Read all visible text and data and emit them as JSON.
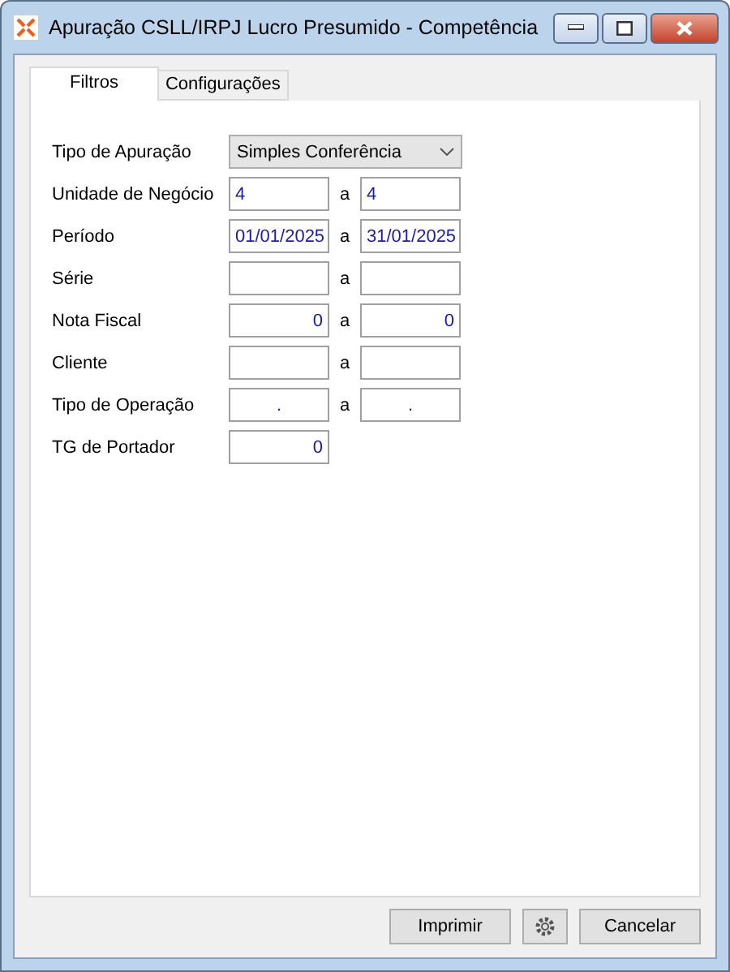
{
  "window": {
    "title": "Apuração CSLL/IRPJ Lucro Presumido - Competência"
  },
  "tabs": [
    {
      "label": "Filtros",
      "selected": true
    },
    {
      "label": "Configurações",
      "selected": false
    }
  ],
  "rows": [
    {
      "kind": "combo",
      "label": "Tipo de Apuração",
      "value": "Simples Conferência"
    },
    {
      "kind": "text-range",
      "label": "Unidade de Negócio",
      "from": "4",
      "separator": "a",
      "to": "4"
    },
    {
      "kind": "text-range",
      "label": "Período",
      "from": "01/01/2025",
      "separator": "a",
      "to": "31/01/2025"
    },
    {
      "kind": "text-range",
      "label": "Série",
      "separator": "a"
    },
    {
      "kind": "number-range",
      "label": "Nota Fiscal",
      "from": "0",
      "separator": "a",
      "to": "0"
    },
    {
      "kind": "text-range",
      "label": "Cliente",
      "separator": "a"
    },
    {
      "kind": "mask-range",
      "label": "Tipo de Operação",
      "from": ".",
      "separator": "a",
      "to": "."
    },
    {
      "kind": "number",
      "label": "TG de Portador",
      "from": "0"
    }
  ],
  "buttons": [
    {
      "kind": "text",
      "label": "Imprimir"
    },
    {
      "kind": "gear"
    },
    {
      "kind": "text",
      "label": "Cancelar"
    }
  ]
}
